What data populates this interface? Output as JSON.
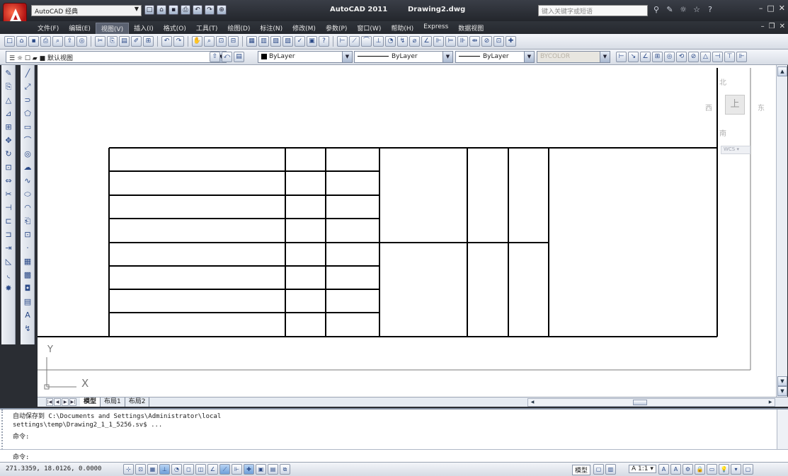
{
  "titlebar": {
    "workspace": "AutoCAD 经典",
    "app_name": "AutoCAD 2011",
    "doc_name": "Drawing2.dwg",
    "search_placeholder": "键入关键字或短语"
  },
  "menu": {
    "items": [
      "文件(F)",
      "编辑(E)",
      "视图(V)",
      "插入(I)",
      "格式(O)",
      "工具(T)",
      "绘图(D)",
      "标注(N)",
      "修改(M)",
      "参数(P)",
      "窗口(W)",
      "帮助(H)",
      "Express",
      "数据视图"
    ],
    "active_index": 2
  },
  "props": {
    "layer": "■ 默认视图",
    "color": "ByLayer",
    "linetype": "ByLayer",
    "lineweight": "ByLayer",
    "plotstyle": "BYCOLOR"
  },
  "viewcube": {
    "north": "北",
    "south": "南",
    "west": "西",
    "east": "东",
    "face": "上",
    "wcs": "WCS"
  },
  "ucs": {
    "x_label": "X",
    "y_label": "Y"
  },
  "layout_tabs": {
    "model": "模型",
    "layout1": "布局1",
    "layout2": "布局2"
  },
  "command": {
    "history1": "自动保存到 C:\\Documents and Settings\\Administrator\\local",
    "history2": "settings\\temp\\Drawing2_1_1_5256.sv$ ...",
    "history3": "命令:",
    "prompt": "命令:"
  },
  "status": {
    "coords": "271.3359, 18.0126, 0.0000",
    "model_label": "模型",
    "scale": "1:1"
  },
  "colors": {
    "accent": "#c41a1a",
    "frame": "#000000",
    "toolbar_bg": "#dfe4ec"
  }
}
